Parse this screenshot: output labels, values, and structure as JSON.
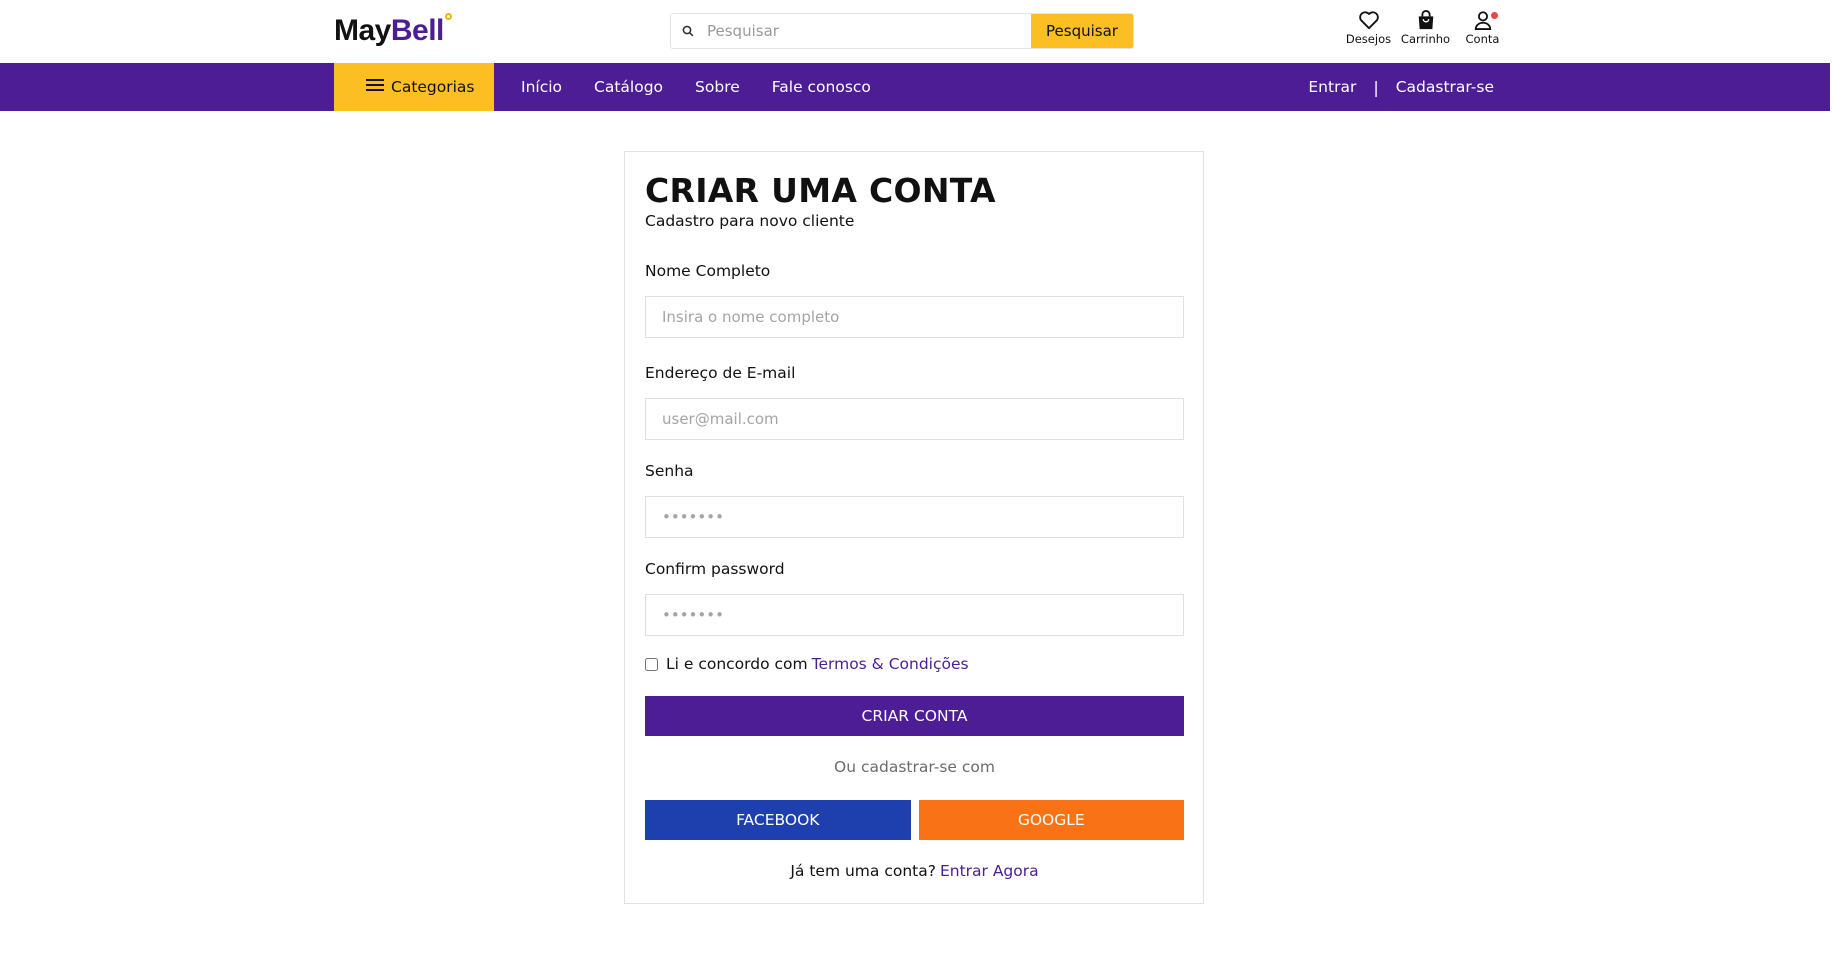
{
  "header": {
    "logo": {
      "part1": "May",
      "part2": "Bell"
    },
    "search": {
      "placeholder": "Pesquisar",
      "button_label": "Pesquisar"
    },
    "icons": [
      {
        "name": "heart-icon",
        "label": "Desejos"
      },
      {
        "name": "bag-icon",
        "label": "Carrinho"
      },
      {
        "name": "user-icon",
        "label": "Conta"
      }
    ]
  },
  "nav": {
    "categories_label": "Categorias",
    "links": [
      "Início",
      "Catálogo",
      "Sobre",
      "Fale conosco"
    ],
    "login_label": "Entrar",
    "separator": "|",
    "register_label": "Cadastrar-se"
  },
  "form": {
    "title": "CRIAR UMA CONTA",
    "subtitle": "Cadastro para novo cliente",
    "name": {
      "label": "Nome Completo",
      "placeholder": "Insira o nome completo"
    },
    "email": {
      "label": "Endereço de E-mail",
      "placeholder": "user@mail.com"
    },
    "password": {
      "label": "Senha",
      "placeholder": "•••••••"
    },
    "confirm": {
      "label": "Confirm password",
      "placeholder": "•••••••"
    },
    "terms_text": "Li e concordo com",
    "terms_link": "Termos & Condições",
    "submit_label": "CRIAR CONTA",
    "or_text": "Ou cadastrar-se com",
    "facebook_label": "FACEBOOK",
    "google_label": "GOOGLE",
    "have_account_text": "Já tem uma conta?",
    "login_link": "Entrar Agora"
  },
  "colors": {
    "brand_purple": "#4c1d95",
    "accent_yellow": "#fbbf24",
    "facebook_blue": "#1e40af",
    "google_orange": "#f97316",
    "badge_red": "#ef4444"
  }
}
